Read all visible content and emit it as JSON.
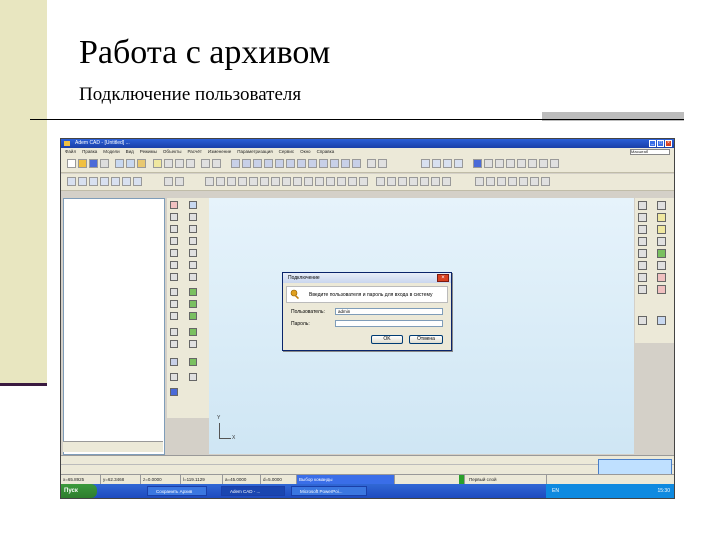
{
  "slide": {
    "title": "Работа с архивом",
    "subtitle": "Подключение пользователя"
  },
  "app": {
    "window_title": "Adem CAD - [Untitled] ...",
    "menu": [
      "Файл",
      "Правка",
      "Модели",
      "Вид",
      "Режимы",
      "Объекты",
      "Расчёт",
      "Изменение",
      "Параметризация",
      "Сервис",
      "Окно",
      "Справка"
    ],
    "scale_box": "Масштаб"
  },
  "dialog": {
    "title": "Подключение",
    "prompt": "Введите пользователя и пароль для входа в систему",
    "user_label": "Пользователь:",
    "user_value": "admin",
    "password_label": "Пароль:",
    "password_value": "",
    "ok_label": "OK",
    "cancel_label": "Отмена"
  },
  "canvas": {
    "axis_x": "X",
    "axis_y": "Y"
  },
  "status": {
    "x": "x=65.8925",
    "y": "y=62.3468",
    "z": "z=0.0000",
    "l": "l=119.1129",
    "a": "a=45.0000",
    "d": "d=5.0000",
    "command": "Выбор команды",
    "layer": "Первый слой"
  },
  "taskbar": {
    "start": "Пуск",
    "tasks": [
      "Сохранить Архив",
      "Adem CAD - ...",
      "Microsoft PowerPoi..."
    ],
    "lang": "EN",
    "time": "15:30"
  }
}
